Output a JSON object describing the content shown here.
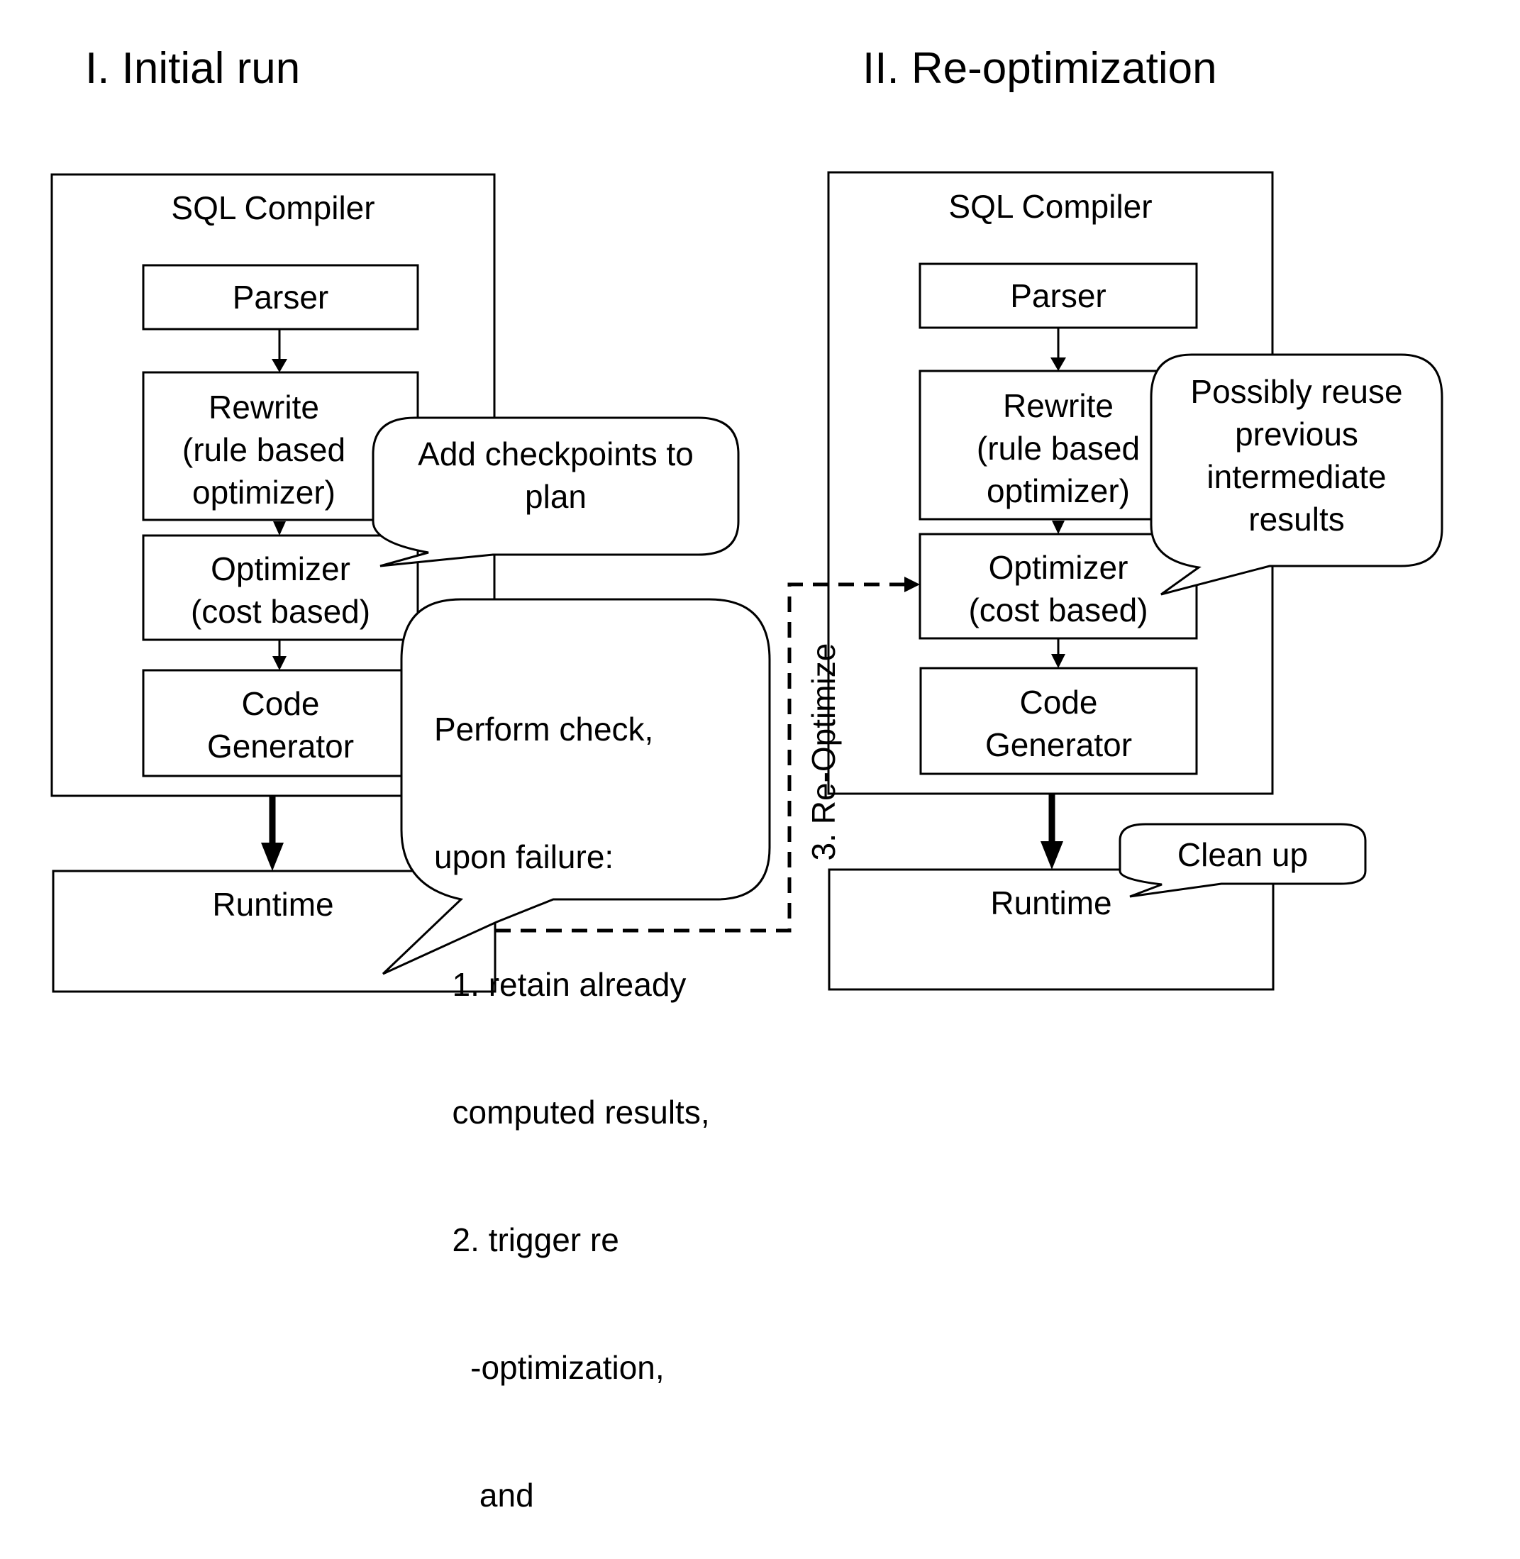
{
  "panels": [
    {
      "id": "initial-run",
      "title": "I. Initial run",
      "compiler": {
        "label": "SQL Compiler",
        "stages": [
          {
            "id": "parser",
            "lines": [
              "Parser"
            ]
          },
          {
            "id": "rewrite",
            "lines": [
              "Rewrite",
              "(rule based",
              "optimizer)"
            ]
          },
          {
            "id": "optimizer",
            "lines": [
              "Optimizer",
              "(cost based)"
            ]
          },
          {
            "id": "code-generator",
            "lines": [
              "Code",
              "Generator"
            ]
          }
        ]
      },
      "runtime": {
        "label": "Runtime"
      },
      "callouts": [
        {
          "id": "add-checkpoints",
          "lines": [
            "Add checkpoints to",
            "plan"
          ]
        },
        {
          "id": "perform-check",
          "lines": [
            "Perform check,",
            "upon failure:",
            "  1. retain already",
            "  computed results,",
            "  2. trigger re",
            "    -optimization,",
            "     and"
          ]
        }
      ]
    },
    {
      "id": "re-optimization",
      "title": "II. Re-optimization",
      "compiler": {
        "label": "SQL Compiler",
        "stages": [
          {
            "id": "parser",
            "lines": [
              "Parser"
            ]
          },
          {
            "id": "rewrite",
            "lines": [
              "Rewrite",
              "(rule based",
              "optimizer)"
            ]
          },
          {
            "id": "optimizer",
            "lines": [
              "Optimizer",
              "(cost based)"
            ]
          },
          {
            "id": "code-generator",
            "lines": [
              "Code",
              "Generator"
            ]
          }
        ]
      },
      "runtime": {
        "label": "Runtime"
      },
      "callouts": [
        {
          "id": "possibly-reuse",
          "lines": [
            "Possibly reuse",
            "previous",
            "intermediate",
            "results"
          ]
        },
        {
          "id": "clean-up",
          "lines": [
            "Clean up"
          ]
        }
      ]
    }
  ],
  "connector": {
    "label": "3. Re-Optimize",
    "style": "dashed",
    "from": "initial-run.runtime",
    "to": "re-optimization.optimizer"
  },
  "colors": {
    "stroke": "#000000",
    "background": "#ffffff"
  }
}
